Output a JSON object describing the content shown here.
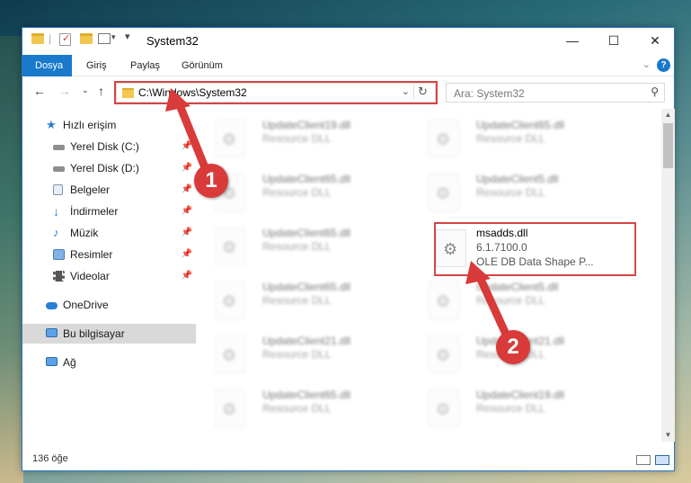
{
  "window": {
    "title": "System32",
    "title_separator": "|",
    "quick_access_dropdown": "▾"
  },
  "ribbon": {
    "tabs": [
      {
        "label": "Dosya",
        "active": true
      },
      {
        "label": "Giriş",
        "active": false
      },
      {
        "label": "Paylaş",
        "active": false
      },
      {
        "label": "Görünüm",
        "active": false
      }
    ],
    "help": "?"
  },
  "navigation": {
    "path": "C:\\Windows\\System32",
    "search_placeholder": "Ara: System32"
  },
  "sidebar": {
    "items": [
      {
        "label": "Hızlı erişim",
        "icon": "star-icon",
        "pinned": false
      },
      {
        "label": "Yerel Disk (C:)",
        "icon": "drive-icon",
        "pinned": true
      },
      {
        "label": "Yerel Disk (D:)",
        "icon": "drive-icon",
        "pinned": true
      },
      {
        "label": "Belgeler",
        "icon": "documents-icon",
        "pinned": true
      },
      {
        "label": "İndirmeler",
        "icon": "download-icon",
        "pinned": true
      },
      {
        "label": "Müzik",
        "icon": "music-icon",
        "pinned": true
      },
      {
        "label": "Resimler",
        "icon": "pictures-icon",
        "pinned": true
      },
      {
        "label": "Videolar",
        "icon": "video-icon",
        "pinned": true
      },
      {
        "label": "OneDrive",
        "icon": "cloud-icon",
        "pinned": false
      },
      {
        "label": "Bu bilgisayar",
        "icon": "computer-icon",
        "pinned": false,
        "selected": true
      },
      {
        "label": "Ağ",
        "icon": "network-icon",
        "pinned": false
      }
    ]
  },
  "files": {
    "left_column": [
      {
        "name": "UpdateClient19.dll",
        "desc": "Resource DLL"
      },
      {
        "name": "UpdateClient65.dll",
        "desc": "Resource DLL"
      },
      {
        "name": "UpdateClient65.dll",
        "desc": "Resource DLL"
      },
      {
        "name": "UpdateClient65.dll",
        "desc": "Resource DLL"
      },
      {
        "name": "UpdateClient21.dll",
        "desc": "Resource DLL"
      },
      {
        "name": "UpdateClient65.dll",
        "desc": "Resource DLL"
      }
    ],
    "right_column": [
      {
        "name": "UpdateClient65.dll",
        "desc": "Resource DLL"
      },
      {
        "name": "UpdateClient5.dll",
        "desc": "Resource DLL"
      },
      {
        "name": "msadds.dll",
        "version": "6.1.7100.0",
        "desc": "OLE DB Data Shape P...",
        "highlighted": true
      },
      {
        "name": "UpdateClient5.dll",
        "desc": "Resource DLL"
      },
      {
        "name": "UpdateClient21.dll",
        "desc": "Resource DLL"
      },
      {
        "name": "UpdateClient19.dll",
        "desc": "Resource DLL"
      }
    ]
  },
  "status": {
    "item_count": "136 öğe"
  },
  "annotations": {
    "step1": "1",
    "step2": "2",
    "color": "#d93a3a"
  },
  "colors": {
    "accent": "#1979ca",
    "highlight_border": "#d64545"
  }
}
